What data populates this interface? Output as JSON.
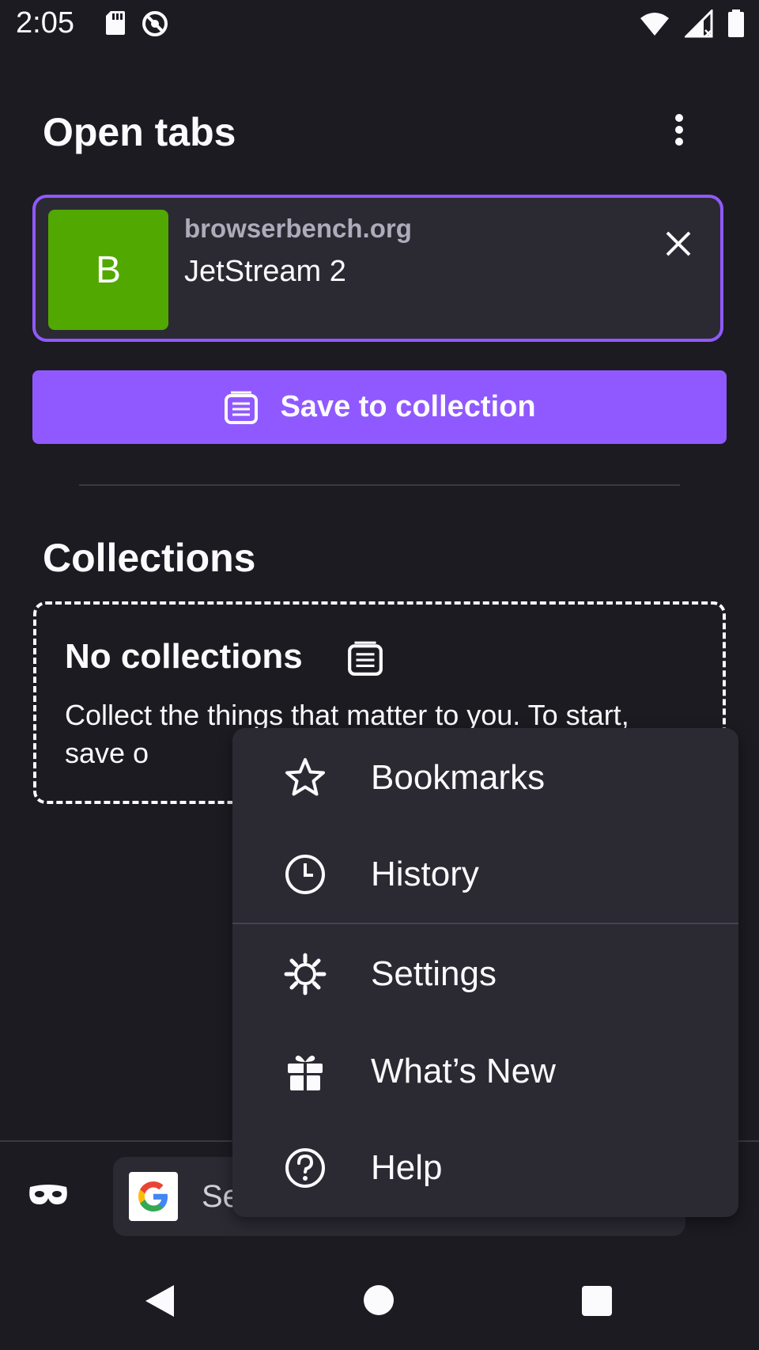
{
  "status_bar": {
    "time": "2:05",
    "left_icons": [
      "sd-card-icon",
      "no-disturb-icon"
    ],
    "right_icons": [
      "wifi-icon",
      "cell-signal-icon",
      "battery-icon"
    ]
  },
  "open_tabs": {
    "title": "Open tabs",
    "menu_icon": "more-vertical-icon",
    "tabs": [
      {
        "thumbnail_letter": "B",
        "thumbnail_color": "#51a800",
        "url": "browserbench.org",
        "title": "JetStream 2"
      }
    ],
    "save_button_label": "Save to collection"
  },
  "collections": {
    "title": "Collections",
    "empty_title": "No collections",
    "empty_text_visible": "Collect the things that matter to you. To start, save o"
  },
  "toolbar": {
    "search_text_visible": "Se",
    "search_engine_icon": "google-icon",
    "private_icon": "private-mask-icon"
  },
  "popup_menu": {
    "items": [
      {
        "label": "Bookmarks",
        "icon": "star-icon"
      },
      {
        "label": "History",
        "icon": "clock-icon"
      },
      {
        "label": "Settings",
        "icon": "gear-icon"
      },
      {
        "label": "What’s New",
        "icon": "gift-icon"
      },
      {
        "label": "Help",
        "icon": "help-icon"
      }
    ]
  },
  "colors": {
    "background": "#1c1b22",
    "surface": "#2b2a33",
    "accent": "#9059ff",
    "text": "#fbfbfe"
  }
}
